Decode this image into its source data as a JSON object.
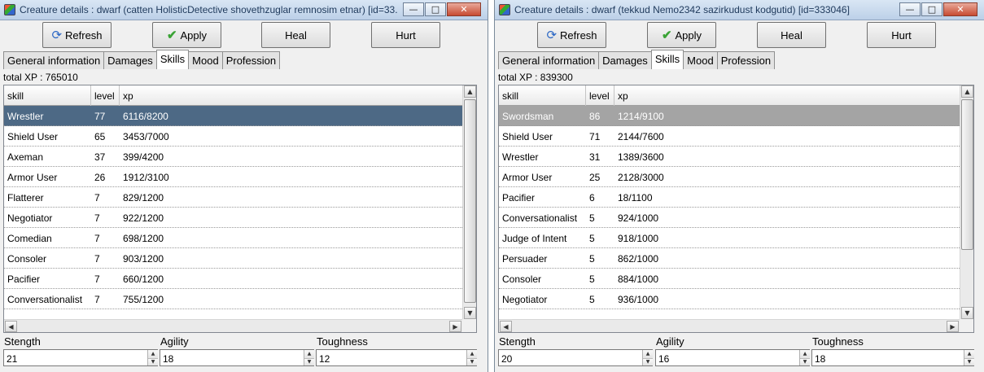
{
  "windows": [
    {
      "title": "Creature details : dwarf (catten HolisticDetective shovethzuglar remnosim etnar) [id=33...",
      "toolbar": {
        "refresh": "Refresh",
        "apply": "Apply",
        "heal": "Heal",
        "hurt": "Hurt"
      },
      "tabs": [
        "General information",
        "Damages",
        "Skills",
        "Mood",
        "Profession"
      ],
      "active_tab": "Skills",
      "total_xp": "total XP : 765010",
      "columns": [
        "skill",
        "level",
        "xp"
      ],
      "rows": [
        {
          "skill": "Wrestler",
          "level": "77",
          "xp": "6116/8200"
        },
        {
          "skill": "Shield User",
          "level": "65",
          "xp": "3453/7000"
        },
        {
          "skill": "Axeman",
          "level": "37",
          "xp": "399/4200"
        },
        {
          "skill": "Armor User",
          "level": "26",
          "xp": "1912/3100"
        },
        {
          "skill": "Flatterer",
          "level": "7",
          "xp": "829/1200"
        },
        {
          "skill": "Negotiator",
          "level": "7",
          "xp": "922/1200"
        },
        {
          "skill": "Comedian",
          "level": "7",
          "xp": "698/1200"
        },
        {
          "skill": "Consoler",
          "level": "7",
          "xp": "903/1200"
        },
        {
          "skill": "Pacifier",
          "level": "7",
          "xp": "660/1200"
        },
        {
          "skill": "Conversationalist",
          "level": "7",
          "xp": "755/1200"
        }
      ],
      "attributes": {
        "strength_label": "Stength",
        "strength": "21",
        "agility_label": "Agility",
        "agility": "18",
        "toughness_label": "Toughness",
        "toughness": "12"
      }
    },
    {
      "title": "Creature details : dwarf (tekkud Nemo2342 sazirkudust kodgutid) [id=333046]",
      "toolbar": {
        "refresh": "Refresh",
        "apply": "Apply",
        "heal": "Heal",
        "hurt": "Hurt"
      },
      "tabs": [
        "General information",
        "Damages",
        "Skills",
        "Mood",
        "Profession"
      ],
      "active_tab": "Skills",
      "total_xp": "total XP : 839300",
      "columns": [
        "skill",
        "level",
        "xp"
      ],
      "rows": [
        {
          "skill": "Swordsman",
          "level": "86",
          "xp": "1214/9100"
        },
        {
          "skill": "Shield User",
          "level": "71",
          "xp": "2144/7600"
        },
        {
          "skill": "Wrestler",
          "level": "31",
          "xp": "1389/3600"
        },
        {
          "skill": "Armor User",
          "level": "25",
          "xp": "2128/3000"
        },
        {
          "skill": "Pacifier",
          "level": "6",
          "xp": "18/1100"
        },
        {
          "skill": "Conversationalist",
          "level": "5",
          "xp": "924/1000"
        },
        {
          "skill": "Judge of Intent",
          "level": "5",
          "xp": "918/1000"
        },
        {
          "skill": "Persuader",
          "level": "5",
          "xp": "862/1000"
        },
        {
          "skill": "Consoler",
          "level": "5",
          "xp": "884/1000"
        },
        {
          "skill": "Negotiator",
          "level": "5",
          "xp": "936/1000"
        }
      ],
      "attributes": {
        "strength_label": "Stength",
        "strength": "20",
        "agility_label": "Agility",
        "agility": "16",
        "toughness_label": "Toughness",
        "toughness": "18"
      }
    }
  ],
  "colors": {
    "selected_row_left": "#4d6985",
    "selected_row_right": "#a4a4a4",
    "titlebar": "#c9daee"
  },
  "icons": {
    "refresh": "refresh-icon",
    "apply": "checkmark-icon"
  }
}
